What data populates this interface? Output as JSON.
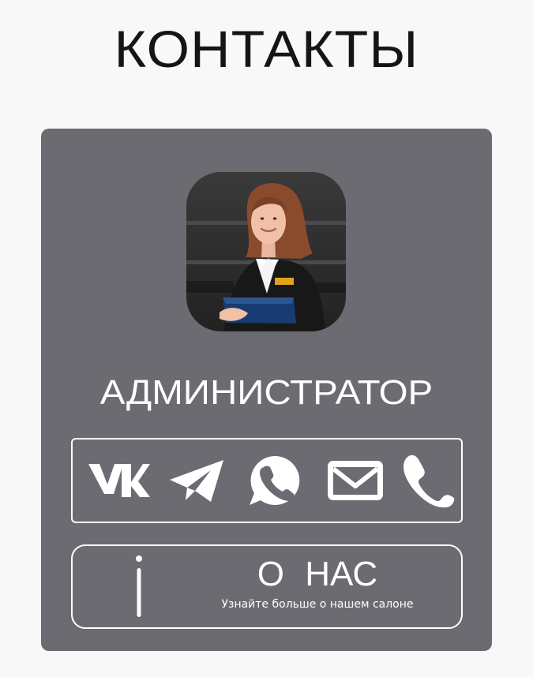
{
  "header": {
    "title": "КОНТАКТЫ"
  },
  "card": {
    "role": "АДМИНИСТРАТОР",
    "avatar": "administrator-photo",
    "contacts": [
      {
        "name": "vk-icon"
      },
      {
        "name": "telegram-icon"
      },
      {
        "name": "whatsapp-icon"
      },
      {
        "name": "mail-icon"
      },
      {
        "name": "phone-icon"
      }
    ],
    "about": {
      "title": "О НАС",
      "subtitle": "Узнайте больше о нашем салоне",
      "icon": "info-icon"
    }
  },
  "colors": {
    "page_background": "#f8f8f8",
    "card_background": "#6b6b71",
    "title_text": "#151515",
    "card_text": "#ffffff"
  }
}
